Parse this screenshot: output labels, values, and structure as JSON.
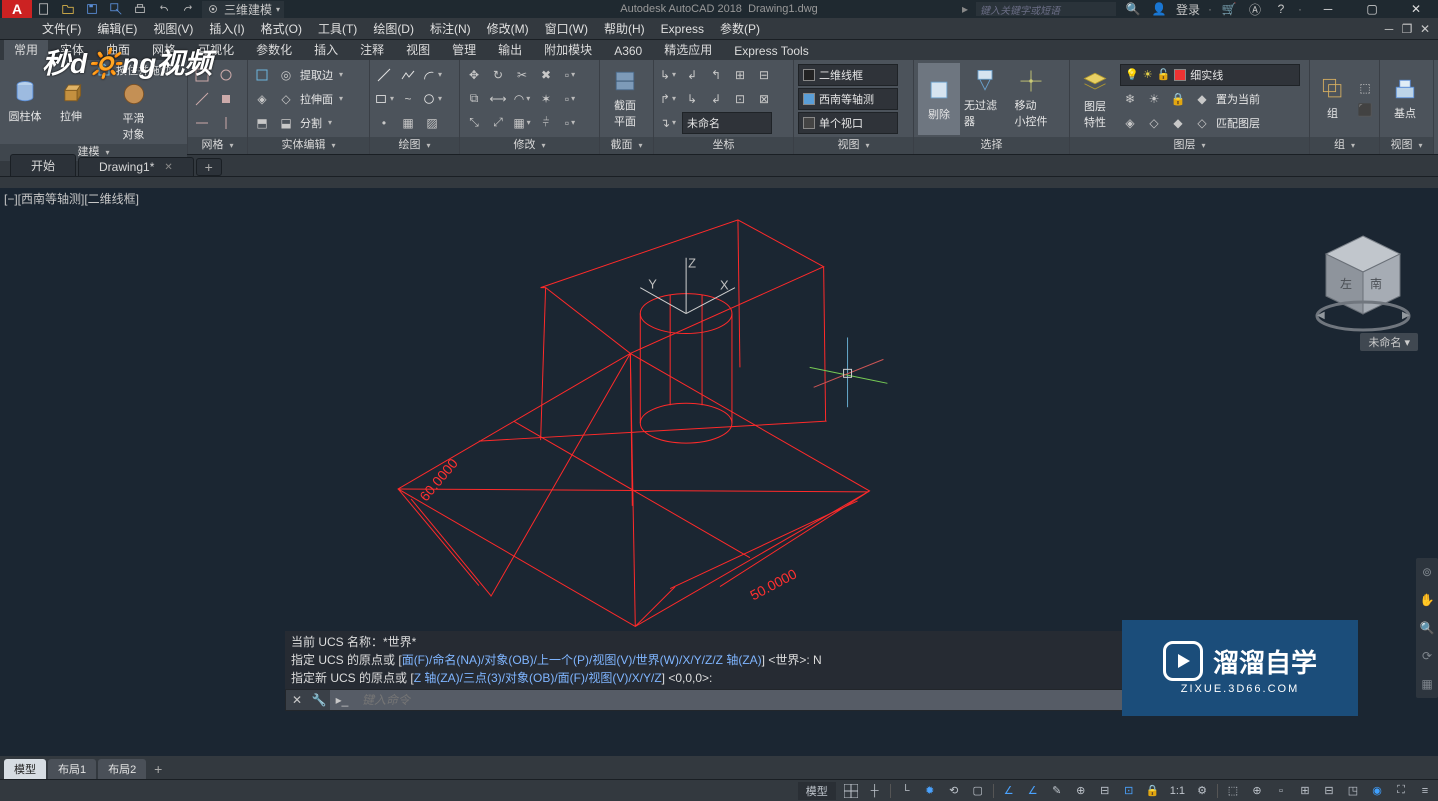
{
  "title": {
    "app": "Autodesk AutoCAD 2018",
    "file": "Drawing1.dwg"
  },
  "workspace_label": "三维建模",
  "search_placeholder": "键入关键字或短语",
  "login_label": "登录",
  "menubar": [
    "文件(F)",
    "编辑(E)",
    "视图(V)",
    "插入(I)",
    "格式(O)",
    "工具(T)",
    "绘图(D)",
    "标注(N)",
    "修改(M)",
    "窗口(W)",
    "帮助(H)",
    "Express",
    "参数(P)"
  ],
  "ribbon_tabs": [
    "常用",
    "实体",
    "曲面",
    "网格",
    "可视化",
    "参数化",
    "插入",
    "注释",
    "视图",
    "管理",
    "输出",
    "附加模块",
    "A360",
    "精选应用",
    "Express Tools"
  ],
  "ribbon_active": 0,
  "panel_model": {
    "title": "建模",
    "big_btns": [
      "圆柱体",
      "拉伸"
    ],
    "row_labels": [
      "按住并拖动",
      "平滑\n对象"
    ]
  },
  "panel_mesh": {
    "title": "网格"
  },
  "panel_solidedit": {
    "title": "实体编辑",
    "labels": [
      "提取边",
      "拉伸面",
      "分割"
    ]
  },
  "panel_draw": {
    "title": "绘图"
  },
  "panel_modify": {
    "title": "修改"
  },
  "panel_section": {
    "title": "截面",
    "big": "截面\n平面"
  },
  "panel_coord": {
    "title": "坐标",
    "dd_name": "未命名"
  },
  "panel_view": {
    "title": "视图",
    "dd_style": "二维线框",
    "dd_view": "西南等轴测",
    "dd_vp": "单个视口"
  },
  "panel_select": {
    "title": "选择",
    "btns": [
      "剔除",
      "无过滤器",
      "移动\n小控件"
    ]
  },
  "panel_layer": {
    "title": "图层",
    "big": "图层\n特性",
    "dd_linetype": "细实线",
    "btns": [
      "置为当前",
      "匹配图层"
    ]
  },
  "panel_group": {
    "title": "组",
    "big": "组"
  },
  "panel_viewpanel": {
    "title": "视图",
    "big": "基点"
  },
  "filetabs": {
    "start": "开始",
    "current": "Drawing1*"
  },
  "viewport_label": "[−][西南等轴测][二维线框]",
  "axes": {
    "x": "X",
    "y": "Y",
    "z": "Z"
  },
  "dims": {
    "d1": "60.0000",
    "d2": "50.0000"
  },
  "viewcube_unnamed": "未命名",
  "cmd_history_0": "当前 UCS 名称：*世界*",
  "cmd_history_1a": "指定 UCS 的原点或 [",
  "cmd_history_1b": "面(F)/命名(NA)/对象(OB)/上一个(P)/视图(V)/世界(W)/X/Y/Z/Z 轴(ZA)",
  "cmd_history_1c": "] <世界>: N",
  "cmd_history_2a": "指定新 UCS 的原点或 [",
  "cmd_history_2b": "Z 轴(ZA)/三点(3)/对象(OB)/面(F)/视图(V)/X/Y/Z",
  "cmd_history_2c": "] <0,0,0>:",
  "cmd_placeholder": "键入命令",
  "zixue_big": "溜溜自学",
  "zixue_small": "ZIXUE.3D66.COM",
  "modeltabs": [
    "模型",
    "布局1",
    "布局2"
  ],
  "statusbar": {
    "model": "模型",
    "scale": "1:1"
  }
}
